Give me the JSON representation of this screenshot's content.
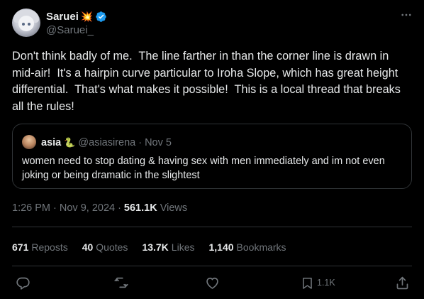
{
  "author": {
    "display_name": "Saruei",
    "name_emoji": "💥",
    "handle": "@Saruei_",
    "verified": true,
    "verified_color": "#1d9bf0"
  },
  "tweet": {
    "text": "Don't think badly of me.  The line farther in than the corner line is drawn in mid-air!  It's a hairpin curve particular to Iroha Slope, which has great height differential.  That's what makes it possible!  This is a local thread that breaks all the rules!",
    "timestamp": "1:26 PM · Nov 9, 2024",
    "separator": "·",
    "views_count": "561.1K",
    "views_label": "Views"
  },
  "quote": {
    "display_name": "asia",
    "name_emoji": "🐍",
    "handle": "@asiasirena",
    "separator": "·",
    "date": "Nov 5",
    "text": "women need to stop dating & having sex with men immediately and im not even joking or being dramatic in the slightest"
  },
  "stats": [
    {
      "value": "671",
      "label": "Reposts"
    },
    {
      "value": "40",
      "label": "Quotes"
    },
    {
      "value": "13.7K",
      "label": "Likes"
    },
    {
      "value": "1,140",
      "label": "Bookmarks"
    }
  ],
  "actions": {
    "reply_icon": "reply-icon",
    "repost_icon": "repost-icon",
    "like_icon": "heart-icon",
    "bookmark_icon": "bookmark-icon",
    "bookmark_count": "1.1K",
    "share_icon": "share-icon"
  },
  "colors": {
    "background": "#000000",
    "text_primary": "#e7e9ea",
    "text_secondary": "#71767b",
    "border": "#2f3336",
    "icon": "#71767b"
  }
}
